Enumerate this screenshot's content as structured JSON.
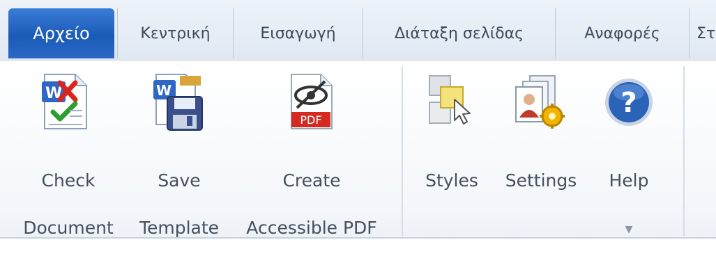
{
  "tabs": [
    {
      "label": "Αρχείο"
    },
    {
      "label": "Κεντρική"
    },
    {
      "label": "Εισαγωγή"
    },
    {
      "label": "Διάταξη σελίδας"
    },
    {
      "label": "Αναφορές"
    },
    {
      "label": "Στ"
    }
  ],
  "ribbon": {
    "check_document": {
      "line1": "Check",
      "line2": "Document",
      "icon": "check-document-icon"
    },
    "save_template": {
      "line1": "Save",
      "line2": "Template",
      "icon": "save-template-icon"
    },
    "create_pdf": {
      "line1": "Create",
      "line2": "Accessible PDF",
      "icon": "accessible-pdf-icon",
      "badge": "PDF"
    },
    "styles": {
      "label": "Styles",
      "icon": "styles-icon"
    },
    "settings": {
      "label": "Settings",
      "icon": "settings-icon"
    },
    "help": {
      "label": "Help",
      "icon": "help-icon",
      "glyph": "?"
    }
  },
  "colors": {
    "file_tab": "#1b5bb8",
    "pdf_red": "#d42a20",
    "help_blue": "#2a63b8"
  }
}
